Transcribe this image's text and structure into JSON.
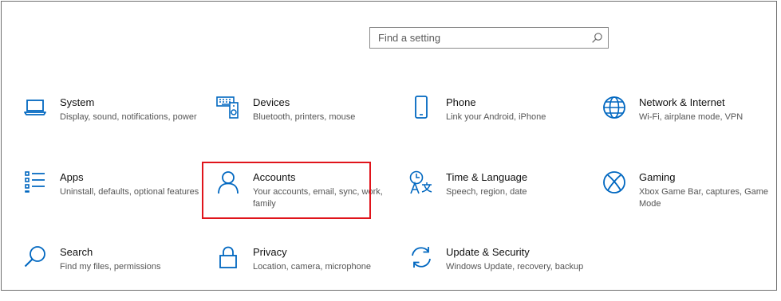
{
  "search": {
    "placeholder": "Find a setting",
    "icon": "search-icon"
  },
  "accent_color": "#0067c0",
  "highlight_color": "#e0141b",
  "categories": [
    {
      "title": "System",
      "desc": "Display, sound, notifications, power",
      "icon": "laptop-icon"
    },
    {
      "title": "Devices",
      "desc": "Bluetooth, printers, mouse",
      "icon": "devices-icon"
    },
    {
      "title": "Phone",
      "desc": "Link your Android, iPhone",
      "icon": "phone-icon"
    },
    {
      "title": "Network & Internet",
      "desc": "Wi-Fi, airplane mode, VPN",
      "icon": "globe-icon"
    },
    {
      "title": "Apps",
      "desc": "Uninstall, defaults, optional features",
      "icon": "apps-list-icon"
    },
    {
      "title": "Accounts",
      "desc": "Your accounts, email, sync, work, family",
      "icon": "person-icon",
      "highlighted": true
    },
    {
      "title": "Time & Language",
      "desc": "Speech, region, date",
      "icon": "time-language-icon"
    },
    {
      "title": "Gaming",
      "desc": "Xbox Game Bar, captures, Game Mode",
      "icon": "xbox-icon"
    },
    {
      "title": "Search",
      "desc": "Find my files, permissions",
      "icon": "search-icon"
    },
    {
      "title": "Privacy",
      "desc": "Location, camera, microphone",
      "icon": "lock-icon"
    },
    {
      "title": "Update & Security",
      "desc": "Windows Update, recovery, backup",
      "icon": "sync-icon"
    }
  ]
}
